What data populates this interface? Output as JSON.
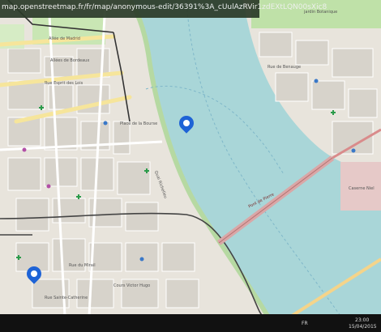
{
  "browser": {
    "url": "map.openstreetmap.fr/fr/map/anonymous-edit/36391%3A_cUulAzRVir1zdEXtLQN00sXic8"
  },
  "map": {
    "labels": {
      "top_right": "jardin Botanique",
      "street_1": "Allée de Madrid",
      "street_2": "Allées de Bordeaux",
      "street_3": "Rue Esprit des Lois",
      "square": "Place de la Bourse",
      "quai": "Quai Richelieu",
      "bridge": "Pont de Pierre",
      "east_1": "Rue de Benauge",
      "east_2": "Caserne Niel",
      "south_1": "Rue du Mirail",
      "south_2": "Cours Victor Hugo",
      "south_3": "Rue Sainte-Catherine"
    },
    "colors": {
      "water": "#a9d6d8",
      "pin": "#1e63d6",
      "rail": "#555555"
    },
    "icons": [
      "map-marker-icon",
      "map-marker-icon-2"
    ]
  },
  "taskbar": {
    "lang": "FR",
    "time": "23:00",
    "date": "15/04/2015"
  }
}
